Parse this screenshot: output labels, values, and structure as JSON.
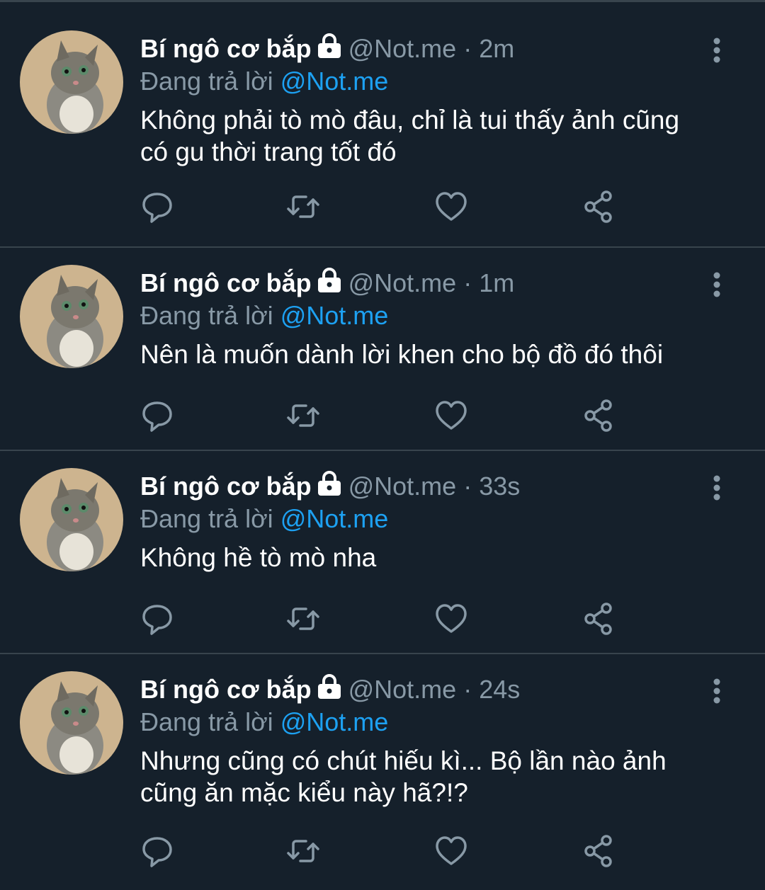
{
  "colors": {
    "background": "#15202b",
    "divider": "#38444d",
    "muted": "#8899a6",
    "accent": "#1da1f2",
    "text": "#ffffff"
  },
  "icons": {
    "lock": "lock-icon",
    "more": "more-vertical-icon",
    "reply": "reply-icon",
    "retweet": "retweet-icon",
    "like": "heart-icon",
    "share": "share-icon"
  },
  "tweets": [
    {
      "display_name": "Bí ngô cơ bắp",
      "handle": "@Not.me",
      "separator": "·",
      "time": "2m",
      "replying_prefix": "Đang trả lời",
      "replying_to": "@Not.me",
      "text_lines": [
        "Không phải tò mò đâu, chỉ là tui thấy ảnh cũng",
        "có gu thời trang tốt đó"
      ]
    },
    {
      "display_name": "Bí ngô cơ bắp",
      "handle": "@Not.me",
      "separator": "·",
      "time": "1m",
      "replying_prefix": "Đang trả lời",
      "replying_to": "@Not.me",
      "text_lines": [
        "Nên là muốn dành lời khen cho bộ đồ đó thôi"
      ]
    },
    {
      "display_name": "Bí ngô cơ bắp",
      "handle": "@Not.me",
      "separator": "·",
      "time": "33s",
      "replying_prefix": "Đang trả lời",
      "replying_to": "@Not.me",
      "text_lines": [
        "Không hề tò mò nha"
      ]
    },
    {
      "display_name": "Bí ngô cơ bắp",
      "handle": "@Not.me",
      "separator": "·",
      "time": "24s",
      "replying_prefix": "Đang trả lời",
      "replying_to": "@Not.me",
      "text_lines": [
        "Nhưng cũng có chút hiếu kì... Bộ lần nào ảnh",
        "cũng ăn mặc kiểu này hã?!?"
      ]
    }
  ]
}
